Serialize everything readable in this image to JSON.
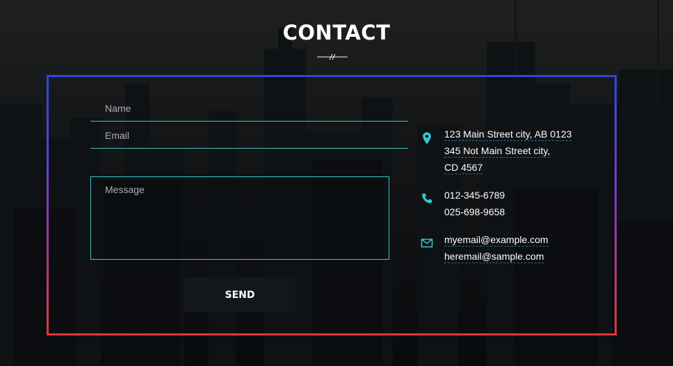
{
  "section": {
    "title": "CONTACT"
  },
  "form": {
    "name_placeholder": "Name",
    "email_placeholder": "Email",
    "message_placeholder": "Message",
    "send_label": "SEND"
  },
  "contact": {
    "address": [
      "123 Main Street city, AB 0123",
      "345 Not Main Street city,",
      "CD 4567"
    ],
    "phones": [
      "012-345-6789",
      "025-698-9658"
    ],
    "emails": [
      "myemail@example.com",
      "heremail@sample.com"
    ]
  },
  "icons": {
    "address": "map-pin-icon",
    "phone": "phone-icon",
    "email": "envelope-icon"
  },
  "colors": {
    "accent": "#36c8c8",
    "frame_top": "#2a48e6",
    "frame_bottom": "#e2373d",
    "button_bg": "#13161b"
  }
}
